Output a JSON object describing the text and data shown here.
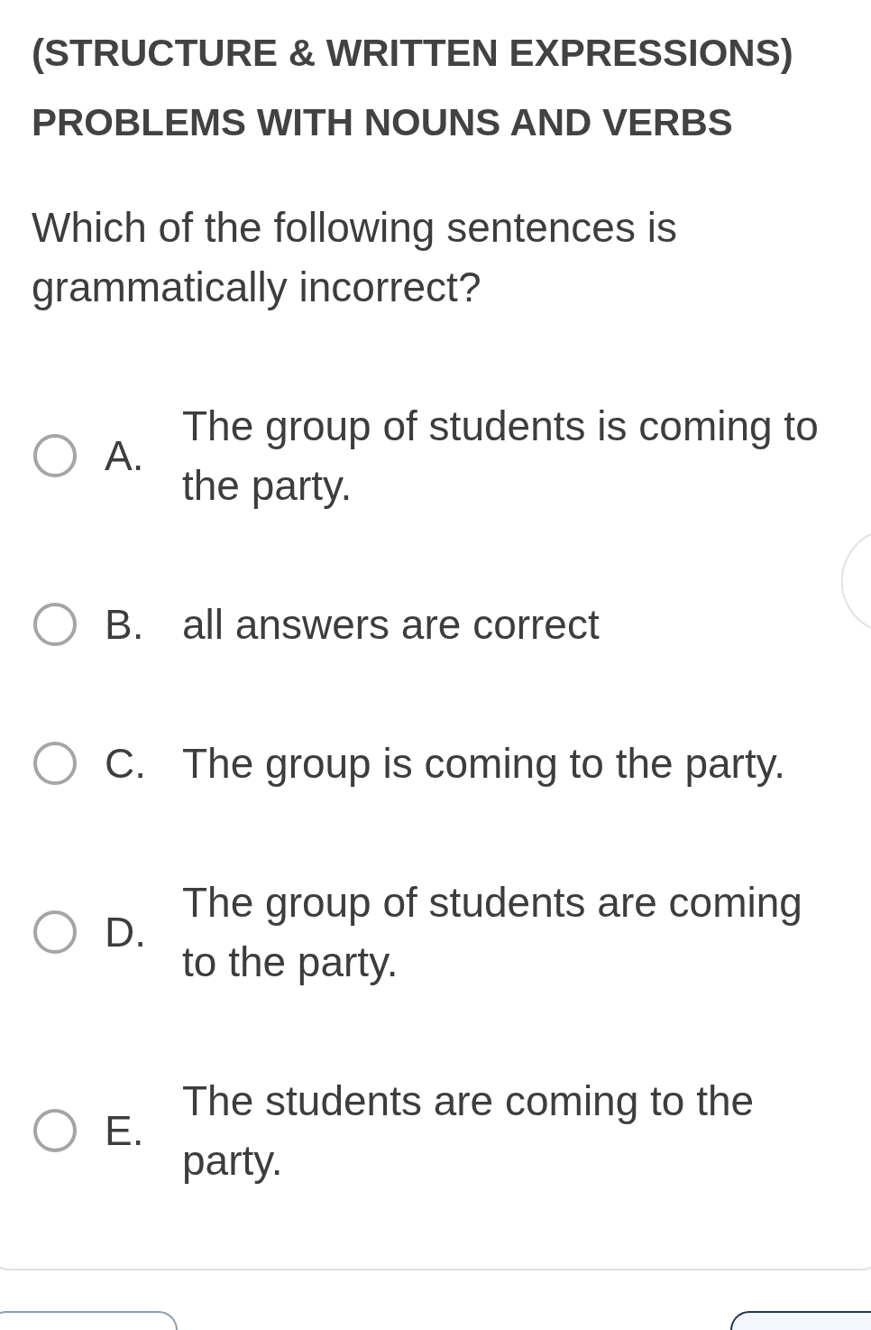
{
  "header": {
    "section_title": "(STRUCTURE & WRITTEN EXPRESSIONS)",
    "topic_title": "PROBLEMS WITH NOUNS AND VERBS"
  },
  "question": {
    "text": "Which of the following sentences is grammatically incorrect?",
    "options": [
      {
        "letter": "A.",
        "text": "The group of students is coming to the party.",
        "selected": false
      },
      {
        "letter": "B.",
        "text": "all answers are correct",
        "selected": false
      },
      {
        "letter": "C.",
        "text": "The group is coming to the party.",
        "selected": false
      },
      {
        "letter": "D.",
        "text": "The group of students are coming to the party.",
        "selected": false
      },
      {
        "letter": "E.",
        "text": "The students are coming to the party.",
        "selected": false
      }
    ]
  },
  "footer_buttons": [
    {
      "kind": "secondary"
    },
    {
      "kind": "primary"
    }
  ]
}
